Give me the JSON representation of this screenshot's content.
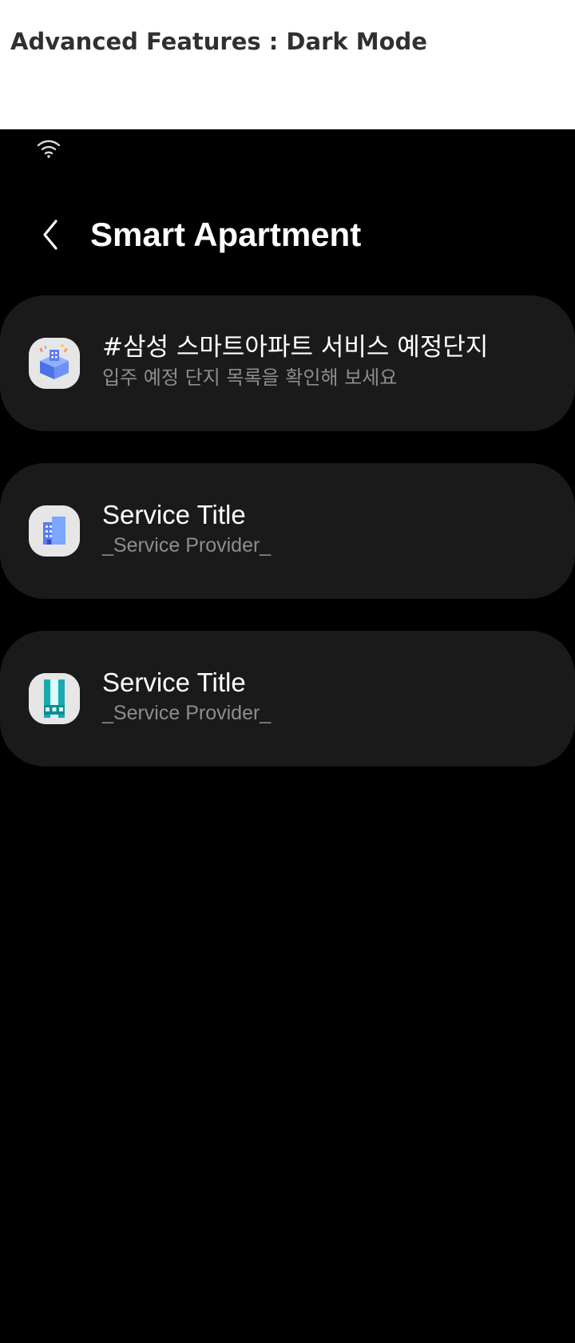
{
  "document_header": {
    "title": "Advanced Features : Dark Mode"
  },
  "status_bar": {
    "wifi_icon": "wifi-icon"
  },
  "app_bar": {
    "back_icon": "chevron-left-icon",
    "title": "Smart Apartment"
  },
  "services": [
    {
      "title": "#삼성 스마트아파트 서비스 예정단지",
      "subtitle": "입주 예정 단지 목록을 확인해 보세요",
      "icon": "apartment-gift-box-icon"
    },
    {
      "title": "Service Title",
      "subtitle": "_Service Provider_",
      "icon": "apartment-building-icon"
    },
    {
      "title": "Service Title",
      "subtitle": "_Service Provider_",
      "icon": "apartment-tower-icon"
    }
  ],
  "colors": {
    "background": "#000000",
    "card": "#1a1a1a",
    "title_text": "#ffffff",
    "subtitle_text": "#8d8d8d",
    "icon_background": "#e6e6e6",
    "accent_blue": "#5b7cf0",
    "accent_teal": "#1aa9ad"
  }
}
